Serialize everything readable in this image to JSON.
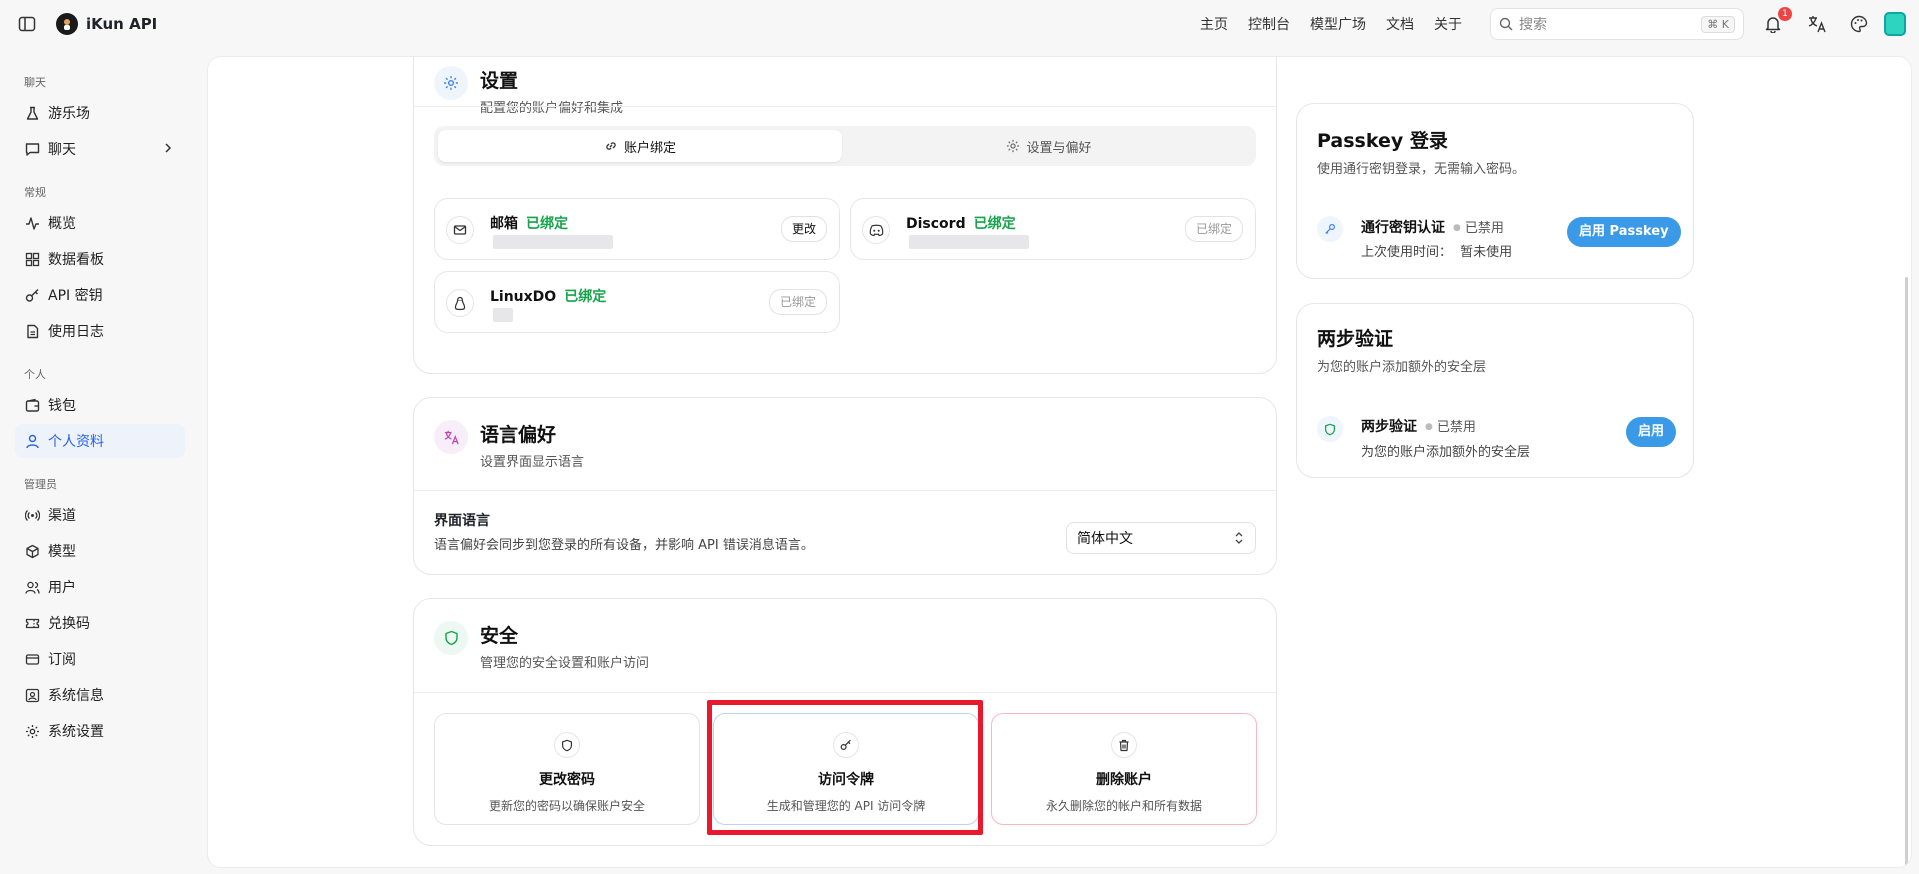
{
  "app": {
    "name": "iKun API"
  },
  "topbar": {
    "nav": [
      "主页",
      "控制台",
      "模型广场",
      "文档",
      "关于"
    ],
    "search_placeholder": "搜索",
    "search_shortcut": "⌘ K",
    "notification_count": "1"
  },
  "sidebar": {
    "sections": [
      {
        "title": "聊天",
        "items": [
          {
            "label": "游乐场",
            "icon": "flask-icon"
          },
          {
            "label": "聊天",
            "icon": "message-icon",
            "expandable": true
          }
        ]
      },
      {
        "title": "常规",
        "items": [
          {
            "label": "概览",
            "icon": "activity-icon"
          },
          {
            "label": "数据看板",
            "icon": "grid-icon"
          },
          {
            "label": "API 密钥",
            "icon": "key-icon"
          },
          {
            "label": "使用日志",
            "icon": "document-icon"
          }
        ]
      },
      {
        "title": "个人",
        "items": [
          {
            "label": "钱包",
            "icon": "wallet-icon"
          },
          {
            "label": "个人资料",
            "icon": "user-icon",
            "active": true
          }
        ]
      },
      {
        "title": "管理员",
        "items": [
          {
            "label": "渠道",
            "icon": "radio-icon"
          },
          {
            "label": "模型",
            "icon": "box-icon"
          },
          {
            "label": "用户",
            "icon": "users-icon"
          },
          {
            "label": "兑换码",
            "icon": "ticket-icon"
          },
          {
            "label": "订阅",
            "icon": "card-icon"
          },
          {
            "label": "系统信息",
            "icon": "info-icon"
          },
          {
            "label": "系统设置",
            "icon": "gear-icon"
          }
        ]
      }
    ]
  },
  "settings": {
    "title": "设置",
    "subtitle": "配置您的账户偏好和集成",
    "tabs": [
      "账户绑定",
      "设置与偏好"
    ],
    "bindings": [
      {
        "name": "邮箱",
        "status": "已绑定",
        "button": "更改"
      },
      {
        "name": "Discord",
        "status": "已绑定",
        "button": "已绑定"
      },
      {
        "name": "LinuxDO",
        "status": "已绑定",
        "button": "已绑定"
      }
    ]
  },
  "language": {
    "title": "语言偏好",
    "subtitle": "设置界面显示语言",
    "label": "界面语言",
    "description": "语言偏好会同步到您登录的所有设备，并影响 API 错误消息语言。",
    "selected": "简体中文"
  },
  "security": {
    "title": "安全",
    "subtitle": "管理您的安全设置和账户访问",
    "actions": [
      {
        "title": "更改密码",
        "desc": "更新您的密码以确保账户安全"
      },
      {
        "title": "访问令牌",
        "desc": "生成和管理您的 API 访问令牌"
      },
      {
        "title": "删除账户",
        "desc": "永久删除您的帐户和所有数据"
      }
    ]
  },
  "passkey": {
    "title": "Passkey 登录",
    "subtitle": "使用通行密钥登录，无需输入密码。",
    "label": "通行密钥认证",
    "state": "已禁用",
    "last_used_label": "上次使用时间：",
    "last_used_value": "暂未使用",
    "button": "启用 Passkey"
  },
  "twofa": {
    "title": "两步验证",
    "subtitle": "为您的账户添加额外的安全层",
    "label": "两步验证",
    "state": "已禁用",
    "desc": "为您的账户添加额外的安全层",
    "button": "启用"
  }
}
